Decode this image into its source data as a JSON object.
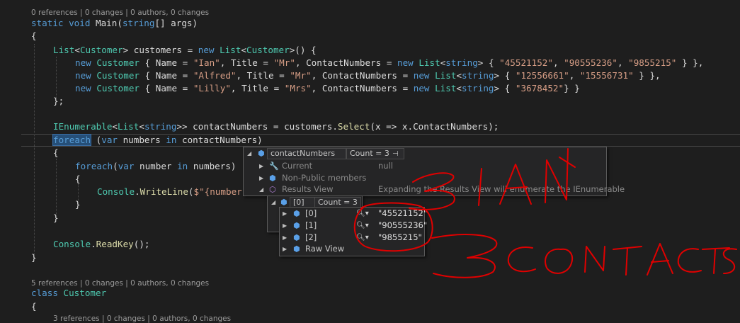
{
  "code": {
    "lens_main": "0 references | 0 changes | 0 authors, 0 changes",
    "lens_class": "5 references | 0 changes | 0 authors, 0 changes",
    "lens_prop": "3 references | 0 changes | 0 authors, 0 changes",
    "lines": {
      "main_sig_kw": "static void",
      "main_sig_name": "Main",
      "main_sig_rest": "(",
      "main_sig_type": "string",
      "main_sig_args": "[] args)",
      "open_brace": "{",
      "close_brace": "}",
      "list_decl_a": "List",
      "list_decl_b": "<",
      "list_decl_c": "Customer",
      "list_decl_d": "> customers = ",
      "list_decl_new": "new",
      "list_decl_e": " List",
      "list_decl_f": "<",
      "list_decl_g": "Customer",
      "list_decl_h": ">() {",
      "new_kw": "new",
      "customer_type": "Customer",
      "c1_a": " { Name = ",
      "c1_name": "\"Ian\"",
      "c1_b": ", Title = ",
      "c1_title": "\"Mr\"",
      "c1_c": ", ContactNumbers = ",
      "c1_list": "List",
      "c1_str": "string",
      "c1_d": "> { ",
      "c1_n1": "\"45521152\"",
      "c1_n2": "\"90555236\"",
      "c1_n3": "\"9855215\"",
      "c1_end": " } },",
      "c2_name": "\"Alfred\"",
      "c2_title": "\"Mr\"",
      "c2_n1": "\"12556661\"",
      "c2_n2": "\"15556731\"",
      "c2_end": " } },",
      "c3_name": "\"Lilly\"",
      "c3_title": "\"Mrs\"",
      "c3_n1": "\"3678452\"",
      "c3_end": "} }",
      "list_close": "};",
      "ienum_a": "IEnumerable",
      "ienum_b": "<",
      "ienum_c": "List",
      "ienum_d": "<",
      "ienum_e": "string",
      "ienum_f": ">> contactNumbers = customers.",
      "ienum_sel": "Select",
      "ienum_g": "(x => x.ContactNumbers);",
      "foreach_kw": "foreach",
      "foreach_a": " (",
      "foreach_var": "var",
      "foreach_b": " numbers ",
      "foreach_in": "in",
      "foreach_c": " contactNumbers)",
      "inner_foreach_kw": "foreach",
      "inner_a": "(",
      "inner_var": "var",
      "inner_b": " number ",
      "inner_in": "in",
      "inner_c": " numbers)",
      "console1_a": "Console",
      "console1_b": ".",
      "console1_c": "WriteLine",
      "console1_d": "(",
      "console1_e": "$\"{number}\"",
      "console1_f": ");",
      "console2_a": "Console",
      "console2_b": ".",
      "console2_c": "ReadKey",
      "console2_d": "();",
      "class_kw": "class",
      "class_name": "Customer"
    }
  },
  "datatip": {
    "header_name": "contactNumbers",
    "header_count": "Count = 3",
    "rows": [
      {
        "name": "Current",
        "value": "null"
      },
      {
        "name": "Non-Public members",
        "value": ""
      },
      {
        "name": "Results View",
        "value": "Expanding the Results View will enumerate the IEnumerable"
      }
    ]
  },
  "subtip": {
    "header_name": "[0]",
    "header_count": "Count = 3",
    "items": [
      {
        "name": "[0]",
        "value": "\"45521152\""
      },
      {
        "name": "[1]",
        "value": "\"90555236\""
      },
      {
        "name": "[2]",
        "value": "\"9855215\""
      }
    ],
    "raw": "Raw View"
  },
  "colors": {
    "background": "#1e1e1e",
    "keyword": "#569cd6",
    "type": "#4ec9b0",
    "string": "#d69d85",
    "method": "#dcdcaa",
    "annotation": "#e00000"
  },
  "annotation": {
    "label_ian": "IAN",
    "label_contacts": "3 CONTACTS"
  }
}
